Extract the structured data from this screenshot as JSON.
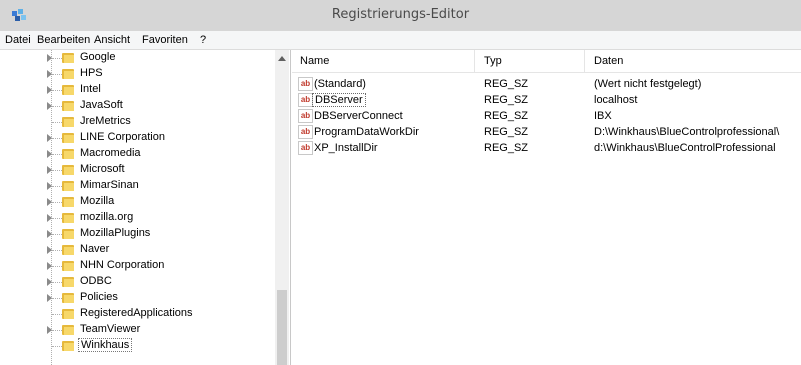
{
  "window": {
    "title": "Registrierungs-Editor"
  },
  "menu": [
    "Datei",
    "Bearbeiten",
    "Ansicht",
    "Favoriten",
    "?"
  ],
  "tree": {
    "items": [
      {
        "label": "Google",
        "expandable": true
      },
      {
        "label": "HPS",
        "expandable": true
      },
      {
        "label": "Intel",
        "expandable": true
      },
      {
        "label": "JavaSoft",
        "expandable": true
      },
      {
        "label": "JreMetrics",
        "expandable": false
      },
      {
        "label": "LINE Corporation",
        "expandable": true
      },
      {
        "label": "Macromedia",
        "expandable": true
      },
      {
        "label": "Microsoft",
        "expandable": true
      },
      {
        "label": "MimarSinan",
        "expandable": true
      },
      {
        "label": "Mozilla",
        "expandable": true
      },
      {
        "label": "mozilla.org",
        "expandable": true
      },
      {
        "label": "MozillaPlugins",
        "expandable": true
      },
      {
        "label": "Naver",
        "expandable": true
      },
      {
        "label": "NHN Corporation",
        "expandable": true
      },
      {
        "label": "ODBC",
        "expandable": true
      },
      {
        "label": "Policies",
        "expandable": true
      },
      {
        "label": "RegisteredApplications",
        "expandable": false
      },
      {
        "label": "TeamViewer",
        "expandable": true
      },
      {
        "label": "Winkhaus",
        "expandable": false
      }
    ],
    "selected_label": "Winkhaus"
  },
  "list": {
    "headers": {
      "name": "Name",
      "type": "Typ",
      "data": "Daten"
    },
    "rows": [
      {
        "name": "(Standard)",
        "type": "REG_SZ",
        "data": "(Wert nicht festgelegt)"
      },
      {
        "name": "DBServer",
        "type": "REG_SZ",
        "data": "localhost"
      },
      {
        "name": "DBServerConnect",
        "type": "REG_SZ",
        "data": "IBX"
      },
      {
        "name": "ProgramDataWorkDir",
        "type": "REG_SZ",
        "data": "D:\\Winkhaus\\BlueControlprofessional\\"
      },
      {
        "name": "XP_InstallDir",
        "type": "REG_SZ",
        "data": "d:\\Winkhaus\\BlueControlProfessional"
      }
    ],
    "focused_row_name": "DBServer",
    "value_icon_text": "ab"
  },
  "icons": {
    "app": "registry-editor-icon",
    "folder": "folder-icon",
    "expander": "expand-arrow-icon",
    "value": "string-value-icon"
  },
  "colors": {
    "titlebar": "#d6d6d6",
    "folder": "#e6b93c",
    "value_icon": "#c0392b"
  }
}
